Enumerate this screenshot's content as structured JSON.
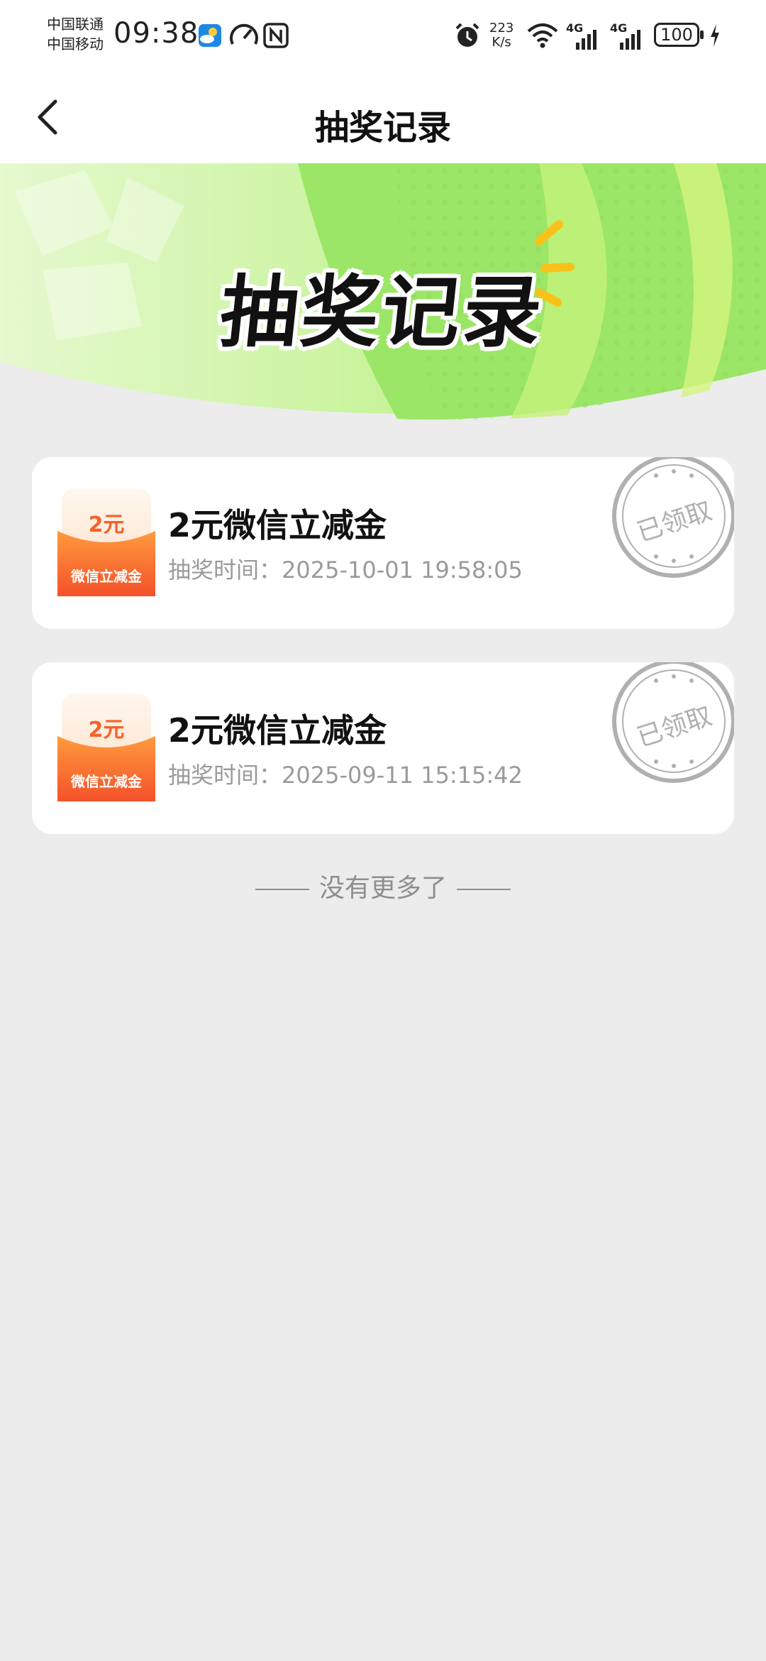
{
  "status_bar": {
    "carrier_1": "中国联通",
    "carrier_2": "中国移动",
    "time": "09:38",
    "net_speed_value": "223",
    "net_speed_unit": "K/s",
    "signal_1": "4G",
    "signal_2": "4G",
    "battery": "100",
    "icons": [
      "weather-icon",
      "speedometer-icon",
      "nfc-icon",
      "alarm-icon",
      "wifi-icon",
      "signal-icon",
      "signal-icon",
      "battery-icon",
      "charging-icon"
    ]
  },
  "header": {
    "title": "抽奖记录",
    "back_icon": "chevron-left-icon"
  },
  "banner": {
    "title": "抽奖记录",
    "colors": {
      "green_light": "#d9f7b0",
      "green": "#8fe25a",
      "lime": "#c9f25a"
    }
  },
  "records": [
    {
      "icon_amount": "2元",
      "icon_label": "微信立减金",
      "name": "2元微信立减金",
      "time": "抽奖时间：2025-10-01 19:58:05",
      "stamp": "已领取"
    },
    {
      "icon_amount": "2元",
      "icon_label": "微信立减金",
      "name": "2元微信立减金",
      "time": "抽奖时间：2025-09-11 15:15:42",
      "stamp": "已领取"
    }
  ],
  "footer": {
    "no_more": "没有更多了"
  },
  "colors": {
    "background": "#ececec",
    "card": "#ffffff",
    "accent_orange": "#f4622a",
    "stamp_gray": "#b0b0b0",
    "muted_text": "#9a9a9a"
  }
}
